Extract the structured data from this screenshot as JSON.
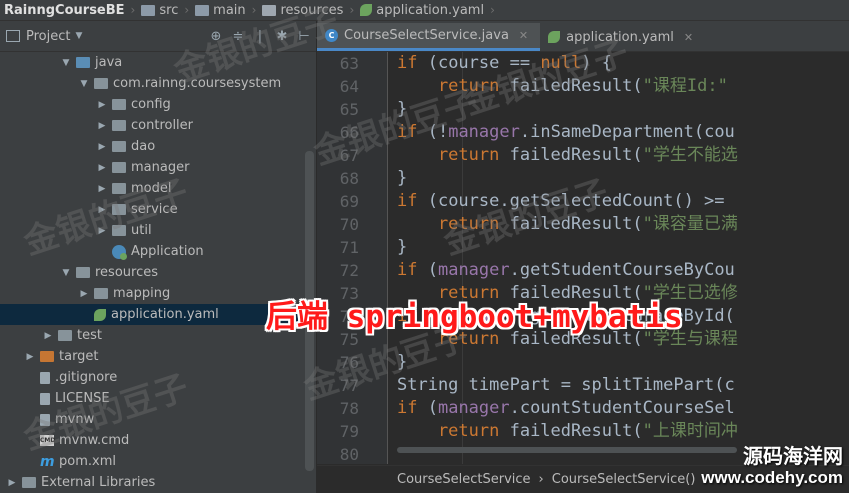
{
  "breadcrumb": [
    "RainngCourseBE",
    "src",
    "main",
    "resources",
    "application.yaml"
  ],
  "project_panel": {
    "title": "Project",
    "tree": [
      {
        "label": "java",
        "indent": 3,
        "arrow": "▼",
        "icon": "folder-blue"
      },
      {
        "label": "com.rainng.coursesystem",
        "indent": 4,
        "arrow": "▼",
        "icon": "package"
      },
      {
        "label": "config",
        "indent": 5,
        "arrow": "▶",
        "icon": "package"
      },
      {
        "label": "controller",
        "indent": 5,
        "arrow": "▶",
        "icon": "package"
      },
      {
        "label": "dao",
        "indent": 5,
        "arrow": "▶",
        "icon": "package"
      },
      {
        "label": "manager",
        "indent": 5,
        "arrow": "▶",
        "icon": "package"
      },
      {
        "label": "model",
        "indent": 5,
        "arrow": "▶",
        "icon": "package"
      },
      {
        "label": "service",
        "indent": 5,
        "arrow": "▶",
        "icon": "package"
      },
      {
        "label": "util",
        "indent": 5,
        "arrow": "▶",
        "icon": "package"
      },
      {
        "label": "Application",
        "indent": 5,
        "arrow": "",
        "icon": "spring-class"
      },
      {
        "label": "resources",
        "indent": 3,
        "arrow": "▼",
        "icon": "folder"
      },
      {
        "label": "mapping",
        "indent": 4,
        "arrow": "▶",
        "icon": "folder"
      },
      {
        "label": "application.yaml",
        "indent": 4,
        "arrow": "",
        "icon": "leaf",
        "selected": true
      },
      {
        "label": "test",
        "indent": 2,
        "arrow": "▶",
        "icon": "folder"
      },
      {
        "label": "target",
        "indent": 1,
        "arrow": "▶",
        "icon": "folder-orange"
      },
      {
        "label": ".gitignore",
        "indent": 1,
        "arrow": "",
        "icon": "file"
      },
      {
        "label": "LICENSE",
        "indent": 1,
        "arrow": "",
        "icon": "file"
      },
      {
        "label": "mvnw",
        "indent": 1,
        "arrow": "",
        "icon": "file"
      },
      {
        "label": "mvnw.cmd",
        "indent": 1,
        "arrow": "",
        "icon": "cmd"
      },
      {
        "label": "pom.xml",
        "indent": 1,
        "arrow": "",
        "icon": "maven"
      },
      {
        "label": "External Libraries",
        "indent": 0,
        "arrow": "▶",
        "icon": "folder"
      }
    ]
  },
  "tabs": [
    {
      "label": "CourseSelectService.java",
      "active": true
    },
    {
      "label": "application.yaml",
      "active": false
    }
  ],
  "line_numbers": [
    "63",
    "64",
    "65",
    "66",
    "67",
    "68",
    "69",
    "70",
    "71",
    "72",
    "73",
    "74",
    "75",
    "76",
    "77",
    "78",
    "79",
    "80"
  ],
  "code_lines": [
    [
      [
        "kw",
        "if"
      ],
      [
        "p",
        " (course == "
      ],
      [
        "kw",
        "null"
      ],
      [
        "p",
        ") {"
      ]
    ],
    [
      [
        "kw",
        "    return"
      ],
      [
        "p",
        " failedResult("
      ],
      [
        "str",
        "\"课程Id:\" "
      ]
    ],
    [
      [
        "p",
        "}"
      ]
    ],
    [
      [
        "kw",
        "if"
      ],
      [
        "p",
        " (!"
      ],
      [
        "fn",
        "manager"
      ],
      [
        "p",
        ".inSameDepartment(cou"
      ]
    ],
    [
      [
        "kw",
        "    return"
      ],
      [
        "p",
        " failedResult("
      ],
      [
        "str",
        "\"学生不能选"
      ]
    ],
    [
      [
        "p",
        "}"
      ]
    ],
    [
      [
        "kw",
        "if"
      ],
      [
        "p",
        " (course.getSelectedCount() >= "
      ]
    ],
    [
      [
        "kw",
        "    return"
      ],
      [
        "p",
        " failedResult("
      ],
      [
        "str",
        "\"课容量已满"
      ]
    ],
    [
      [
        "p",
        "}"
      ]
    ],
    [
      [
        "kw",
        "if"
      ],
      [
        "p",
        " ("
      ],
      [
        "fn",
        "manager"
      ],
      [
        "p",
        ".getStudentCourseByCou"
      ]
    ],
    [
      [
        "kw",
        "    return"
      ],
      [
        "p",
        " failedResult("
      ],
      [
        "str",
        "\"学生已选修"
      ]
    ],
    [
      [
        "kw",
        "if"
      ],
      [
        "p",
        " (!"
      ],
      [
        "fn",
        "manager"
      ],
      [
        "p",
        ".getStudentGradeById("
      ]
    ],
    [
      [
        "kw",
        "    return"
      ],
      [
        "p",
        " failedResult("
      ],
      [
        "str",
        "\"学生与课程"
      ]
    ],
    [
      [
        "p",
        "}"
      ]
    ],
    [
      [
        "p",
        "String timePart = splitTimePart(c"
      ]
    ],
    [
      [
        "kw",
        "if"
      ],
      [
        "p",
        " ("
      ],
      [
        "fn",
        "manager"
      ],
      [
        "p",
        ".countStudentCourseSel"
      ]
    ],
    [
      [
        "kw",
        "    return"
      ],
      [
        "p",
        " failedResult("
      ],
      [
        "str",
        "\"上课时间冲"
      ]
    ]
  ],
  "bottom_breadcrumb": [
    "CourseSelectService",
    "CourseSelectService()"
  ],
  "caption": "后端 springboot+mybatis",
  "watermarks": [
    "金银的豆子"
  ],
  "corner_watermark": {
    "title": "源码海洋网",
    "url": "www.codehy.com"
  }
}
